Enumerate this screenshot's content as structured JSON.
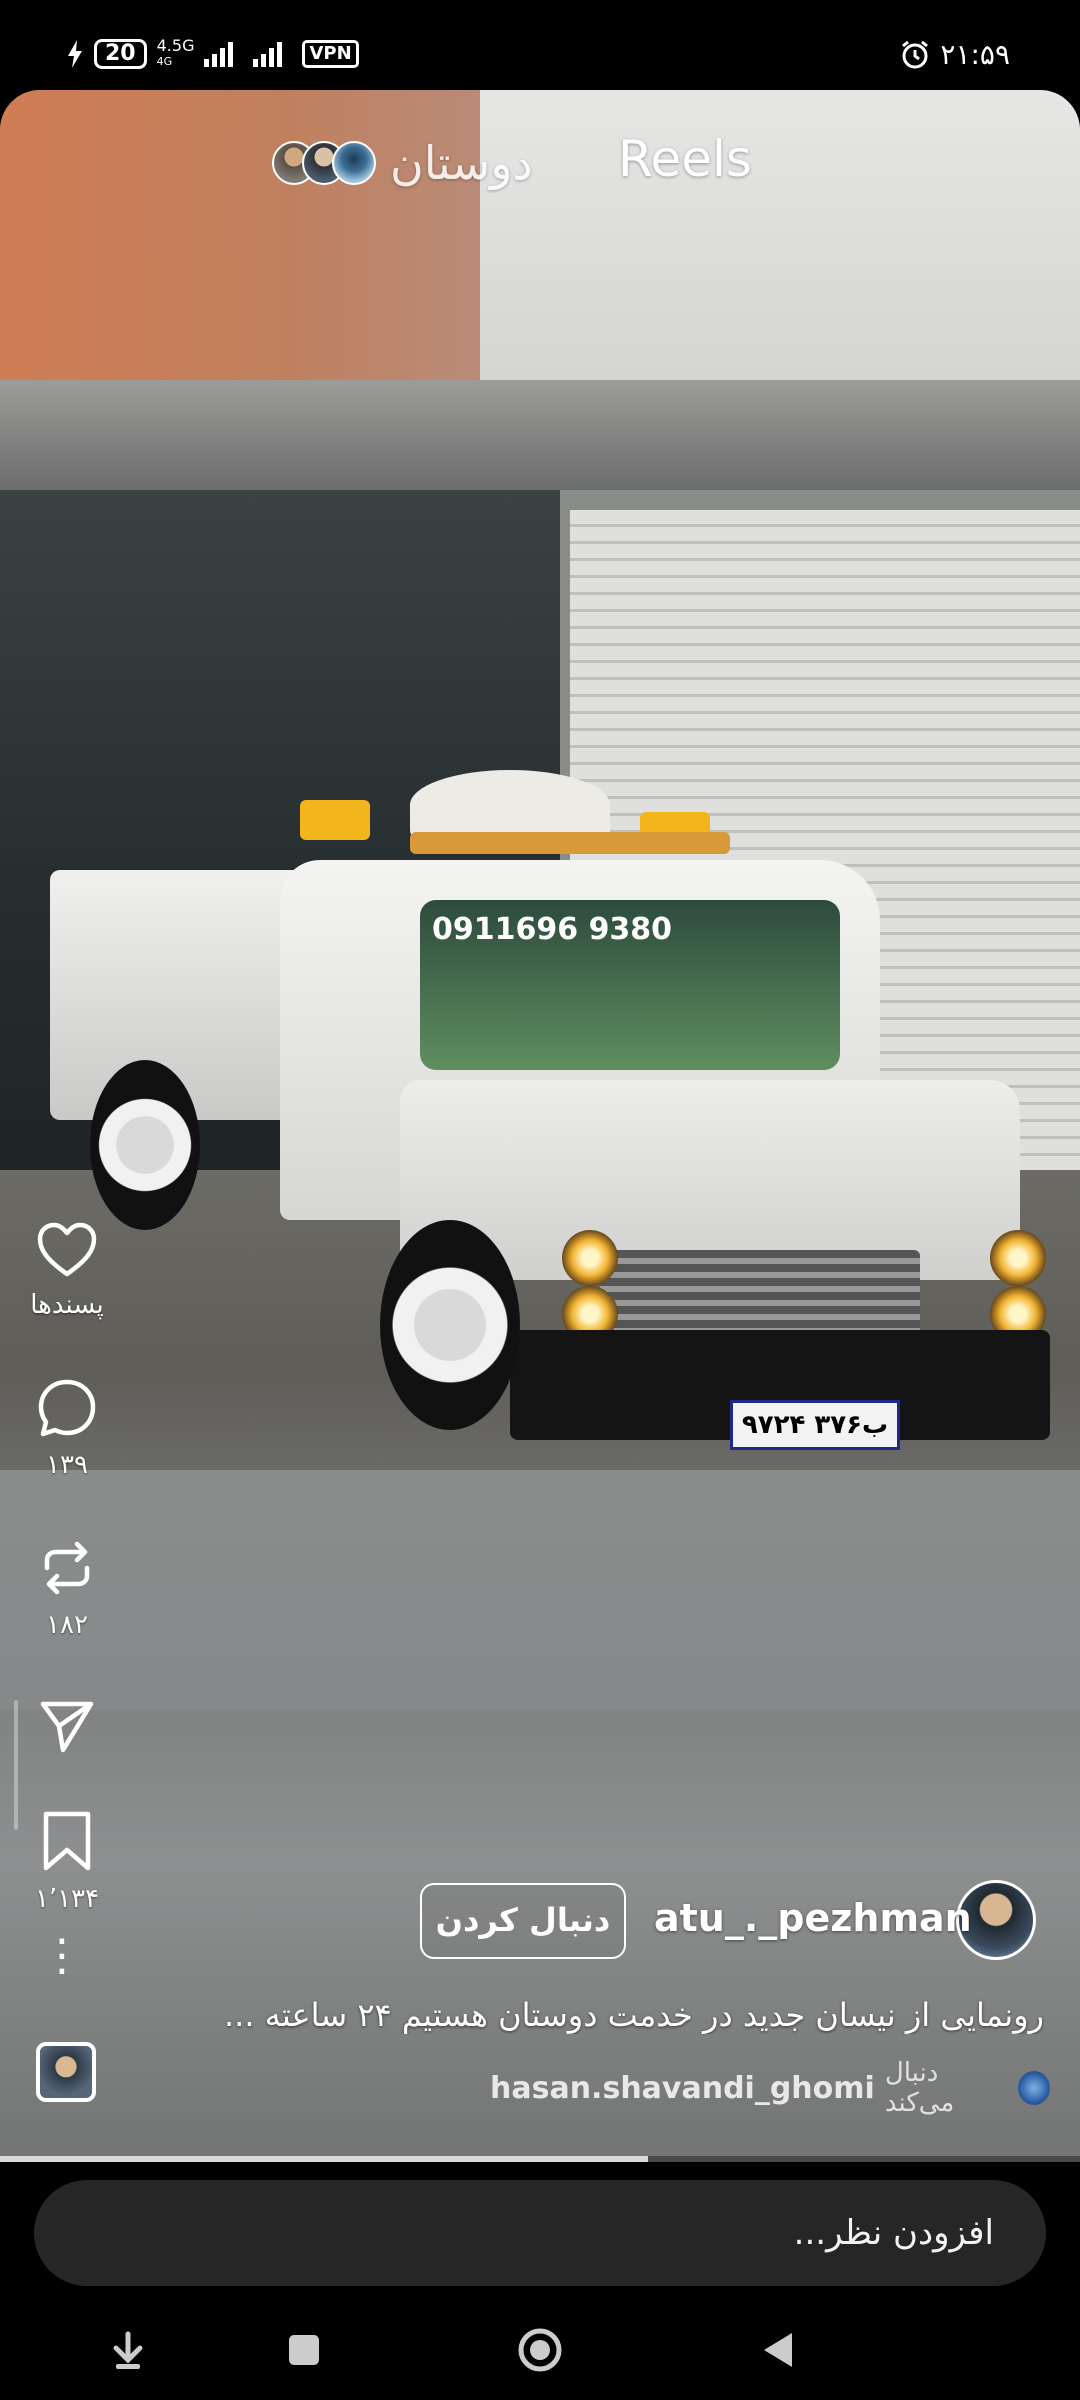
{
  "status_bar": {
    "battery": "20",
    "network": "4.5G",
    "network_sub": "4G",
    "vpn": "VPN",
    "time": "۲۱:۵۹",
    "icons": [
      "charging-icon",
      "battery-icon",
      "signal-icon",
      "signal-icon",
      "vpn-badge",
      "alarm-icon"
    ]
  },
  "header": {
    "title": "Reels",
    "friends_label": "دوستان",
    "friend_avatars": 3
  },
  "video": {
    "windshield_phone": "0911696 9380",
    "plate": "۹۷ب۳۷۶ ۲۴"
  },
  "actions": {
    "like_label": "پسندها",
    "comments_count": "۱۳۹",
    "reposts_count": "۱۸۲",
    "saves_count": "۱٬۱۳۴",
    "icons": [
      "heart-icon",
      "comment-icon",
      "repost-icon",
      "send-icon",
      "bookmark-icon",
      "more-icon"
    ]
  },
  "author": {
    "username": "atu_._pezhman",
    "follow_label": "دنبال کردن"
  },
  "caption": "رونمایی از نیسان جدید در خدمت دوستان هستیم ۲۴ ساعته ...",
  "followed_by": {
    "text": "دنبال می‌کند",
    "username": "hasan.shavandi_ghomi"
  },
  "progress": {
    "fraction": 0.6
  },
  "comment": {
    "placeholder": "افزودن نظر..."
  },
  "navbar": {
    "icons": [
      "down-arrow-icon",
      "recents-icon",
      "home-icon",
      "back-icon"
    ]
  }
}
